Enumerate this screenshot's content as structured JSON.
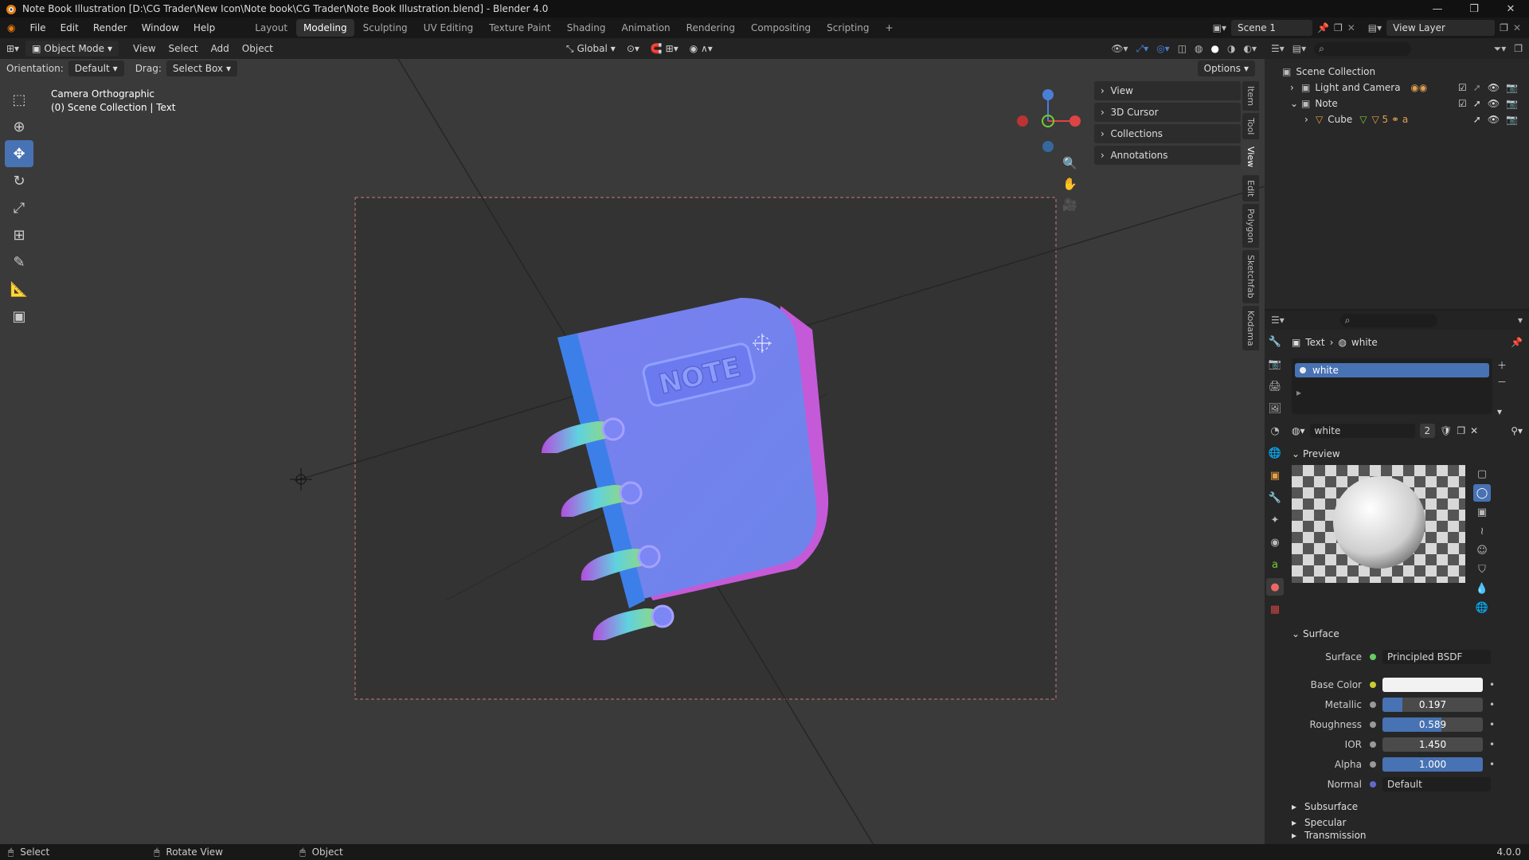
{
  "titlebar": {
    "title": "Note Book Illustration [D:\\CG Trader\\New Icon\\Note book\\CG Trader\\Note Book Illustration.blend] - Blender 4.0"
  },
  "menubar": {
    "menus": [
      "File",
      "Edit",
      "Render",
      "Window",
      "Help"
    ],
    "workspaces": [
      "Layout",
      "Modeling",
      "Sculpting",
      "UV Editing",
      "Texture Paint",
      "Shading",
      "Animation",
      "Rendering",
      "Compositing",
      "Scripting"
    ],
    "active_workspace": "Modeling",
    "scene": "Scene 1",
    "view_layer": "View Layer"
  },
  "vheader": {
    "mode": "Object Mode",
    "menus": [
      "View",
      "Select",
      "Add",
      "Object"
    ],
    "transform": "Global"
  },
  "toolsettings": {
    "orientation_label": "Orientation:",
    "orientation": "Default",
    "drag_label": "Drag:",
    "drag": "Select Box",
    "options": "Options"
  },
  "viewport": {
    "camera": "Camera Orthographic",
    "context": "(0) Scene Collection | Text",
    "note_text": "NOTE"
  },
  "npanel": {
    "items": [
      "View",
      "3D Cursor",
      "Collections",
      "Annotations"
    ],
    "tabs": [
      "Item",
      "Tool",
      "View",
      "Edit",
      "Polygon",
      "Sketchfab",
      "Kodama"
    ]
  },
  "outliner": {
    "root": "Scene Collection",
    "items": [
      "Light and Camera",
      "Note",
      "Cube"
    ]
  },
  "properties": {
    "breadcrumb_obj": "Text",
    "breadcrumb_mat": "white",
    "slot": "white",
    "material_name": "white",
    "users": "2",
    "preview": "Preview",
    "surface_panel": "Surface",
    "surface_label": "Surface",
    "surface_value": "Principled BSDF",
    "fields": [
      {
        "label": "Base Color",
        "value": "",
        "fill": 0
      },
      {
        "label": "Metallic",
        "value": "0.197",
        "fill": 0.197
      },
      {
        "label": "Roughness",
        "value": "0.589",
        "fill": 0.589
      },
      {
        "label": "IOR",
        "value": "1.450",
        "fill": 0
      },
      {
        "label": "Alpha",
        "value": "1.000",
        "fill": 1.0
      }
    ],
    "normal_label": "Normal",
    "normal_value": "Default",
    "subpanels": [
      "Subsurface",
      "Specular",
      "Transmission"
    ]
  },
  "statusbar": {
    "select": "Select",
    "rotate": "Rotate View",
    "object": "Object",
    "version": "4.0.0"
  },
  "colors": {
    "accent": "#4772b3",
    "header": "#232323"
  }
}
